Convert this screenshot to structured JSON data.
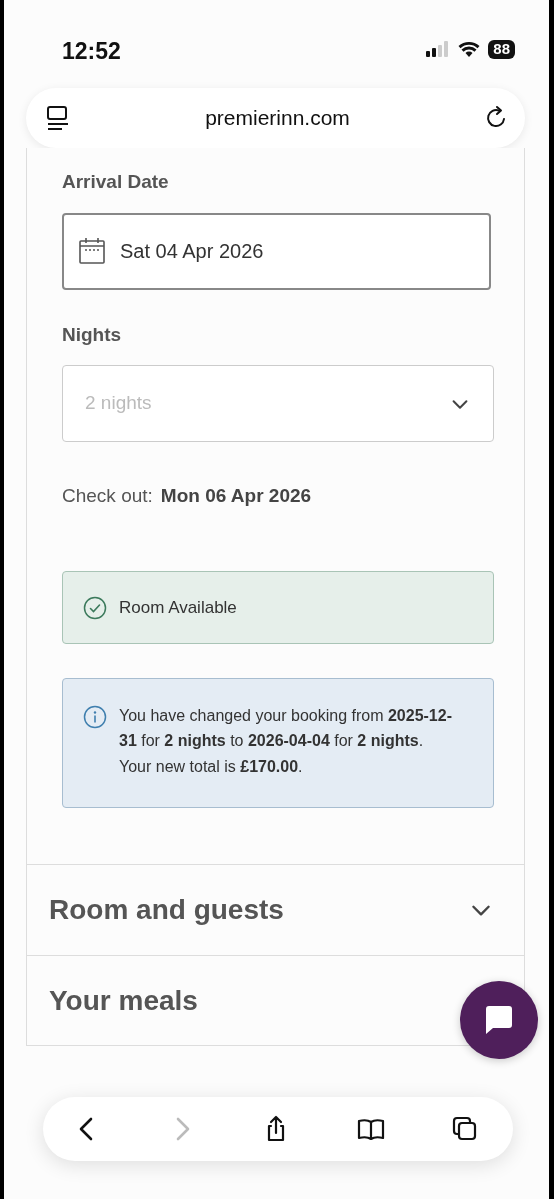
{
  "status_bar": {
    "time": "12:52",
    "battery": "88"
  },
  "address_bar": {
    "url": "premierinn.com"
  },
  "arrival_date": {
    "label": "Arrival Date",
    "value": "Sat 04 Apr 2026"
  },
  "nights": {
    "label": "Nights",
    "value": "2 nights",
    "disabled": true
  },
  "check_out": {
    "label": "Check out:",
    "value": "Mon 06 Apr 2026"
  },
  "alerts": [
    {
      "kind": "success",
      "text": "Room Available"
    },
    {
      "kind": "info",
      "text": "You have changed your booking from **2025-12-31** for **2 nights** to **2026-04-04** for **2 nights**. Your new total is **£170.00**."
    }
  ],
  "sections": [
    {
      "title": "Room and guests",
      "expanded": false
    },
    {
      "title": "Your meals"
    }
  ],
  "toolbar": [
    {
      "kind": "back",
      "disabled": false
    },
    {
      "kind": "forward",
      "disabled": true
    },
    {
      "kind": "share",
      "disabled": false
    },
    {
      "kind": "bookmarks",
      "disabled": false
    },
    {
      "kind": "tabs",
      "disabled": false
    }
  ]
}
